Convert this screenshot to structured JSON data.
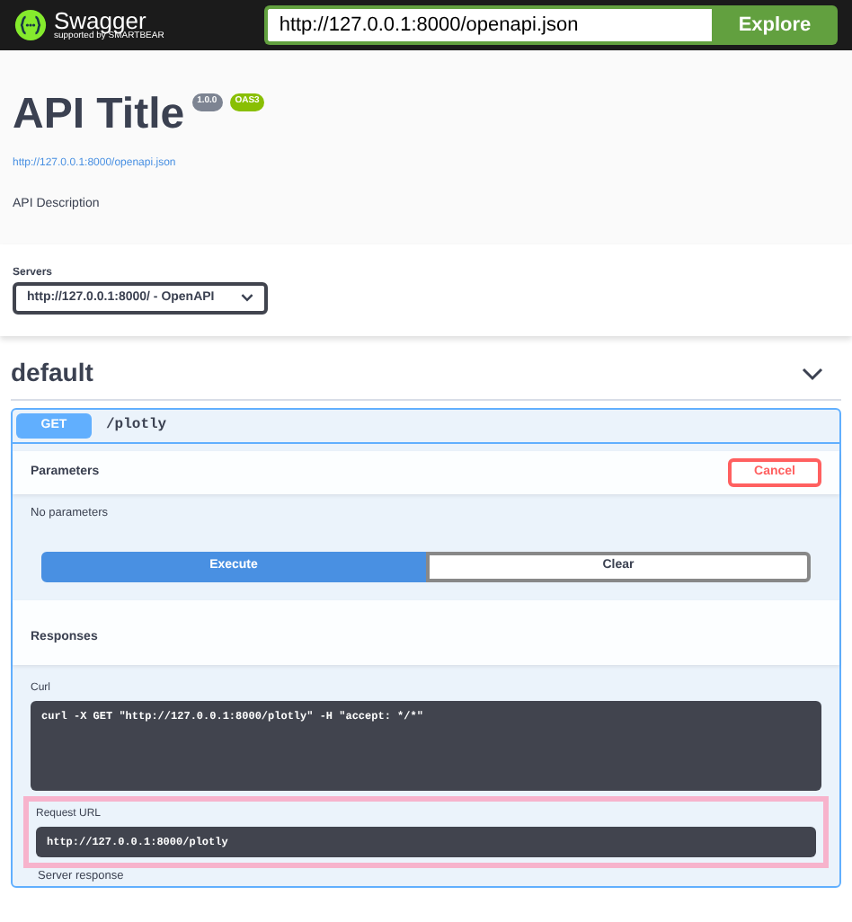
{
  "topbar": {
    "brand": "Swagger",
    "brand_sub": "supported by SMARTBEAR",
    "url": "http://127.0.0.1:8000/openapi.json",
    "explore": "Explore"
  },
  "info": {
    "title": "API Title",
    "version": "1.0.0",
    "oas": "OAS3",
    "spec_link": "http://127.0.0.1:8000/openapi.json",
    "description": "API Description"
  },
  "servers": {
    "label": "Servers",
    "value": "http://127.0.0.1:8000/ - OpenAPI"
  },
  "tag": {
    "name": "default",
    "expanded": true
  },
  "operation": {
    "method": "GET",
    "path": "/plotly",
    "params_title": "Parameters",
    "cancel": "Cancel",
    "no_params": "No parameters",
    "execute": "Execute",
    "clear": "Clear",
    "responses_title": "Responses",
    "blocks": [
      {
        "label": "Curl",
        "code": "curl -X GET \"http://127.0.0.1:8000/plotly\" -H \"accept: */*\"",
        "highlighted": false,
        "tall": true
      },
      {
        "label": "Request URL",
        "code": "http://127.0.0.1:8000/plotly",
        "highlighted": true,
        "tall": false
      }
    ],
    "server_response": "Server response"
  }
}
